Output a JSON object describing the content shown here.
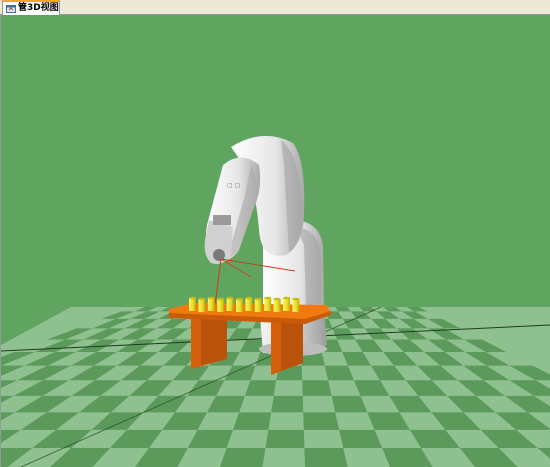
{
  "window": {
    "tab_label": "管3D视图",
    "tab_icon": "3d-view-icon"
  },
  "scene": {
    "background_color": "#5fa55f",
    "floor_light_color": "#8fc08f",
    "floor_dark_color": "#5b9a5b",
    "table_color": "#f07a10",
    "table_leg_color": "#d4610a",
    "cup_color": "#f2ea2c",
    "robot_color": "#e8e8e8",
    "laser_color": "#d43b1a",
    "cup_count": 12
  }
}
